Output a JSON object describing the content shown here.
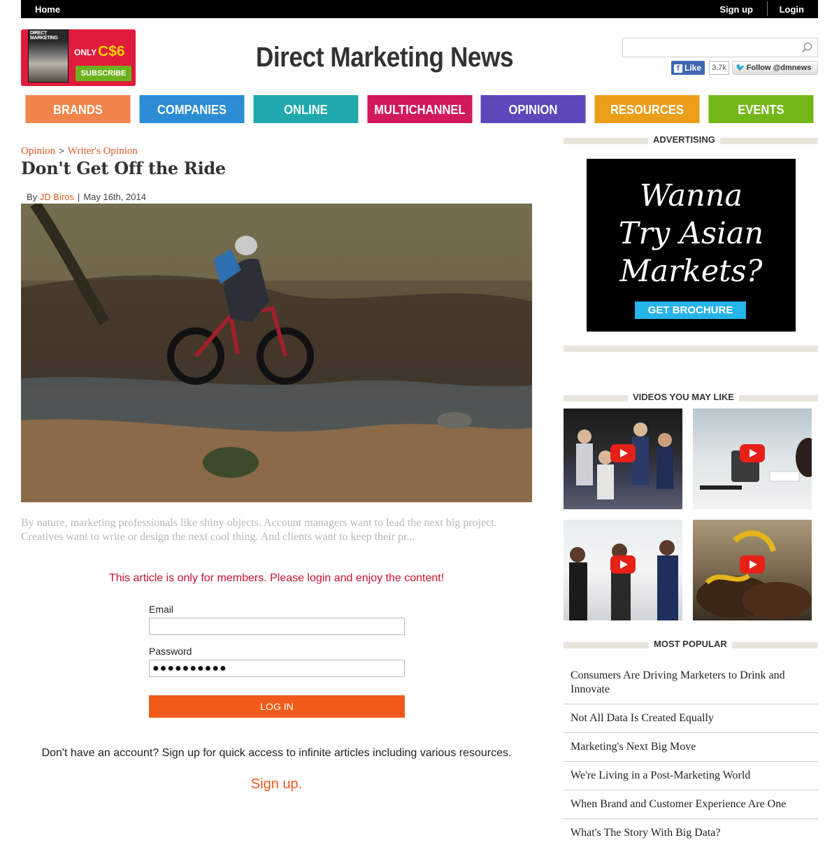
{
  "topbar": {
    "home": "Home",
    "signup": "Sign up",
    "login": "Login"
  },
  "promo": {
    "cover_title": "DIRECT MARKETING",
    "only": "ONLY",
    "price": "C$6",
    "subscribe": "SUBSCRIBE"
  },
  "site": {
    "title": "Direct Marketing News"
  },
  "search": {
    "placeholder": ""
  },
  "social": {
    "fb_like": "Like",
    "fb_count": "3.7k",
    "twitter_follow": "Follow @dmnews"
  },
  "nav": [
    {
      "label": "BRANDS",
      "color": "#f0844a"
    },
    {
      "label": "COMPANIES",
      "color": "#2c8cd4"
    },
    {
      "label": "ONLINE",
      "color": "#20a9ad"
    },
    {
      "label": "MULTICHANNEL",
      "color": "#d2195b"
    },
    {
      "label": "OPINION",
      "color": "#5c48bb"
    },
    {
      "label": "RESOURCES",
      "color": "#eb9e19"
    },
    {
      "label": "EVENTS",
      "color": "#74b718"
    }
  ],
  "article": {
    "breadcrumb": [
      "Opinion",
      "Writer's Opinion"
    ],
    "breadcrumb_sep": ">",
    "title": "Don't Get Off the Ride",
    "by": "By",
    "author": "JD Biros",
    "sep": "|",
    "date": "May 16th, 2014",
    "excerpt": "By nature, marketing professionals like shiny objects. Account managers want to lead the next big project. Creatives want to write or design the next cool thing. And clients want to keep their pr..."
  },
  "login": {
    "members_message": "This article is only for members. Please login and enjoy the content!",
    "email_label": "Email",
    "email_value": "",
    "password_label": "Password",
    "password_value": "●●●●●●●●●●",
    "button": "LOG IN",
    "signup_message": "Don't have an account? Sign up for quick access to infinite articles including various resources.",
    "signup_link": "Sign up."
  },
  "sidebar": {
    "advertising_heading": "ADVERTISING",
    "ad": {
      "headline_lines": [
        "Wanna",
        "Try Asian",
        "Markets?"
      ],
      "button": "GET BROCHURE"
    },
    "videos_heading": "VIDEOS YOU MAY LIKE",
    "most_popular_heading": "MOST POPULAR",
    "most_popular": [
      "Consumers Are Driving Marketers to Drink and Innovate",
      "Not All Data Is Created Equally",
      "Marketing's Next Big Move",
      "We're Living in a Post-Marketing World",
      "When Brand and Customer Experience Are One",
      "What's The Story With Big Data?"
    ]
  },
  "colors": {
    "accent": "#f05a1a",
    "alert": "#c8102e",
    "breadcrumb": "#e05a20"
  }
}
